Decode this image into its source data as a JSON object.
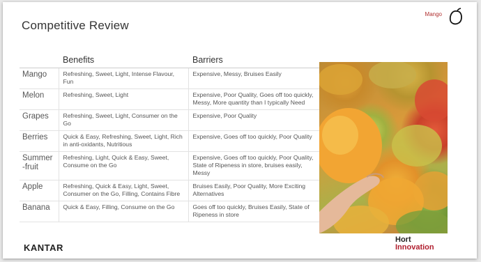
{
  "header": {
    "title": "Competitive Review",
    "brand": "Mango",
    "brand_icon": "mango-outline-icon"
  },
  "table": {
    "headers": [
      "",
      "Benefits",
      "Barriers"
    ],
    "rows": [
      {
        "fruit": "Mango",
        "benefits": "Refreshing, Sweet, Light, Intense Flavour, Fun",
        "barriers": "Expensive, Messy, Bruises Easily"
      },
      {
        "fruit": "Melon",
        "benefits": "Refreshing, Sweet, Light",
        "barriers": "Expensive, Poor Quality, Goes off too quickly, Messy, More quantity than I typically Need"
      },
      {
        "fruit": "Grapes",
        "benefits": "Refreshing, Sweet, Light, Consumer on the Go",
        "barriers": "Expensive, Poor Quality"
      },
      {
        "fruit": "Berries",
        "benefits": "Quick & Easy, Refreshing, Sweet, Light, Rich in anti-oxidants, Nutritious",
        "barriers": "Expensive, Goes off too quickly, Poor Quality"
      },
      {
        "fruit": "Summer\n-fruit",
        "benefits": "Refreshing, Light, Quick & Easy, Sweet, Consume on the Go",
        "barriers": "Expensive, Goes off too quickly, Poor Quality, State of Ripeness in store, bruises easily, Messy"
      },
      {
        "fruit": "Apple",
        "benefits": "Refreshing, Quick & Easy, Light, Sweet, Consumer on the Go, Filling, Contains Fibre",
        "barriers": "Bruises Easily, Poor Quality, More Exciting Alternatives"
      },
      {
        "fruit": "Banana",
        "benefits": "Quick & Easy, Filling, Consume on the Go",
        "barriers": "Goes off too quickly, Bruises Easily, State of Ripeness in store"
      }
    ]
  },
  "footer": {
    "left_logo": "KANTAR",
    "right_logo_line1": "Hort",
    "right_logo_line2": "Innovation"
  },
  "colors": {
    "accent": "#b01e2e",
    "text": "#555555"
  }
}
